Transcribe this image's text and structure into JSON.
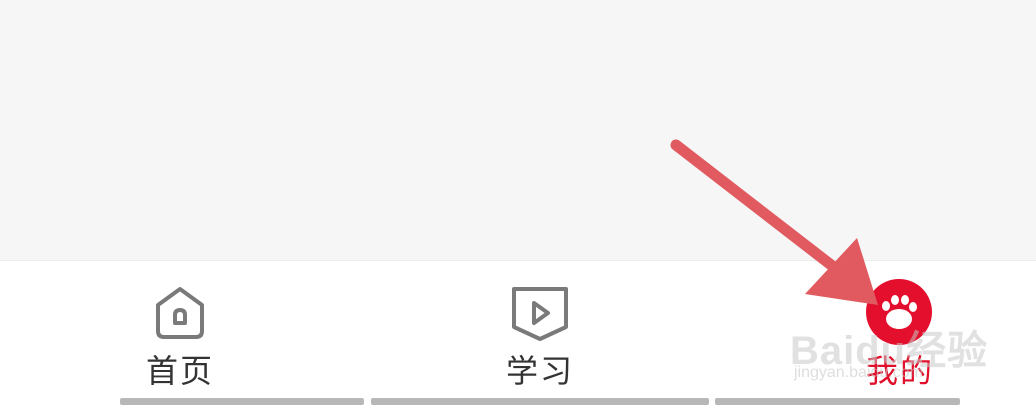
{
  "tabs": [
    {
      "label": "首页",
      "icon": "home-icon",
      "active": false
    },
    {
      "label": "学习",
      "icon": "play-video-icon",
      "active": false
    },
    {
      "label": "我的",
      "icon": "avatar",
      "active": true
    }
  ],
  "watermark": {
    "text": "Baidu经验",
    "sub": "jingyan.baidu.com"
  },
  "colors": {
    "active_tab": "#e0102a",
    "inactive_tab": "#333333",
    "icon_stroke": "#7a7a7a",
    "annotation_arrow": "#e05a60"
  }
}
